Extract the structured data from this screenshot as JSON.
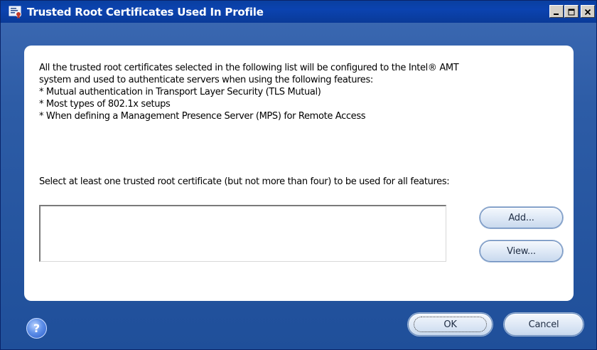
{
  "window": {
    "title": "Trusted Root Certificates Used In Profile",
    "app_icon": "certificate-app-icon",
    "controls": {
      "minimize_icon": "minimize-icon",
      "maximize_icon": "maximize-icon",
      "close_icon": "close-icon"
    }
  },
  "description": {
    "lines": [
      "All the trusted root certificates selected in the following list will be configured to the Intel® AMT",
      "system and used to authenticate servers when using the following features:",
      "* Mutual authentication in Transport Layer Security (TLS Mutual)",
      "* Most types of 802.1x setups",
      "* When defining a Management Presence Server (MPS) for Remote Access"
    ]
  },
  "selection": {
    "prompt": "Select at least one trusted root certificate (but not more than four) to be used for all features:",
    "certificates": []
  },
  "buttons": {
    "add": "Add...",
    "view": "View...",
    "ok": "OK",
    "cancel": "Cancel",
    "help": "?"
  },
  "colors": {
    "window_background": "#2d5ca6",
    "titlebar": "#0b43b0",
    "panel": "#ffffff",
    "button_gradient_top": "#f4f8fd",
    "button_gradient_bottom": "#c9d9ee"
  }
}
